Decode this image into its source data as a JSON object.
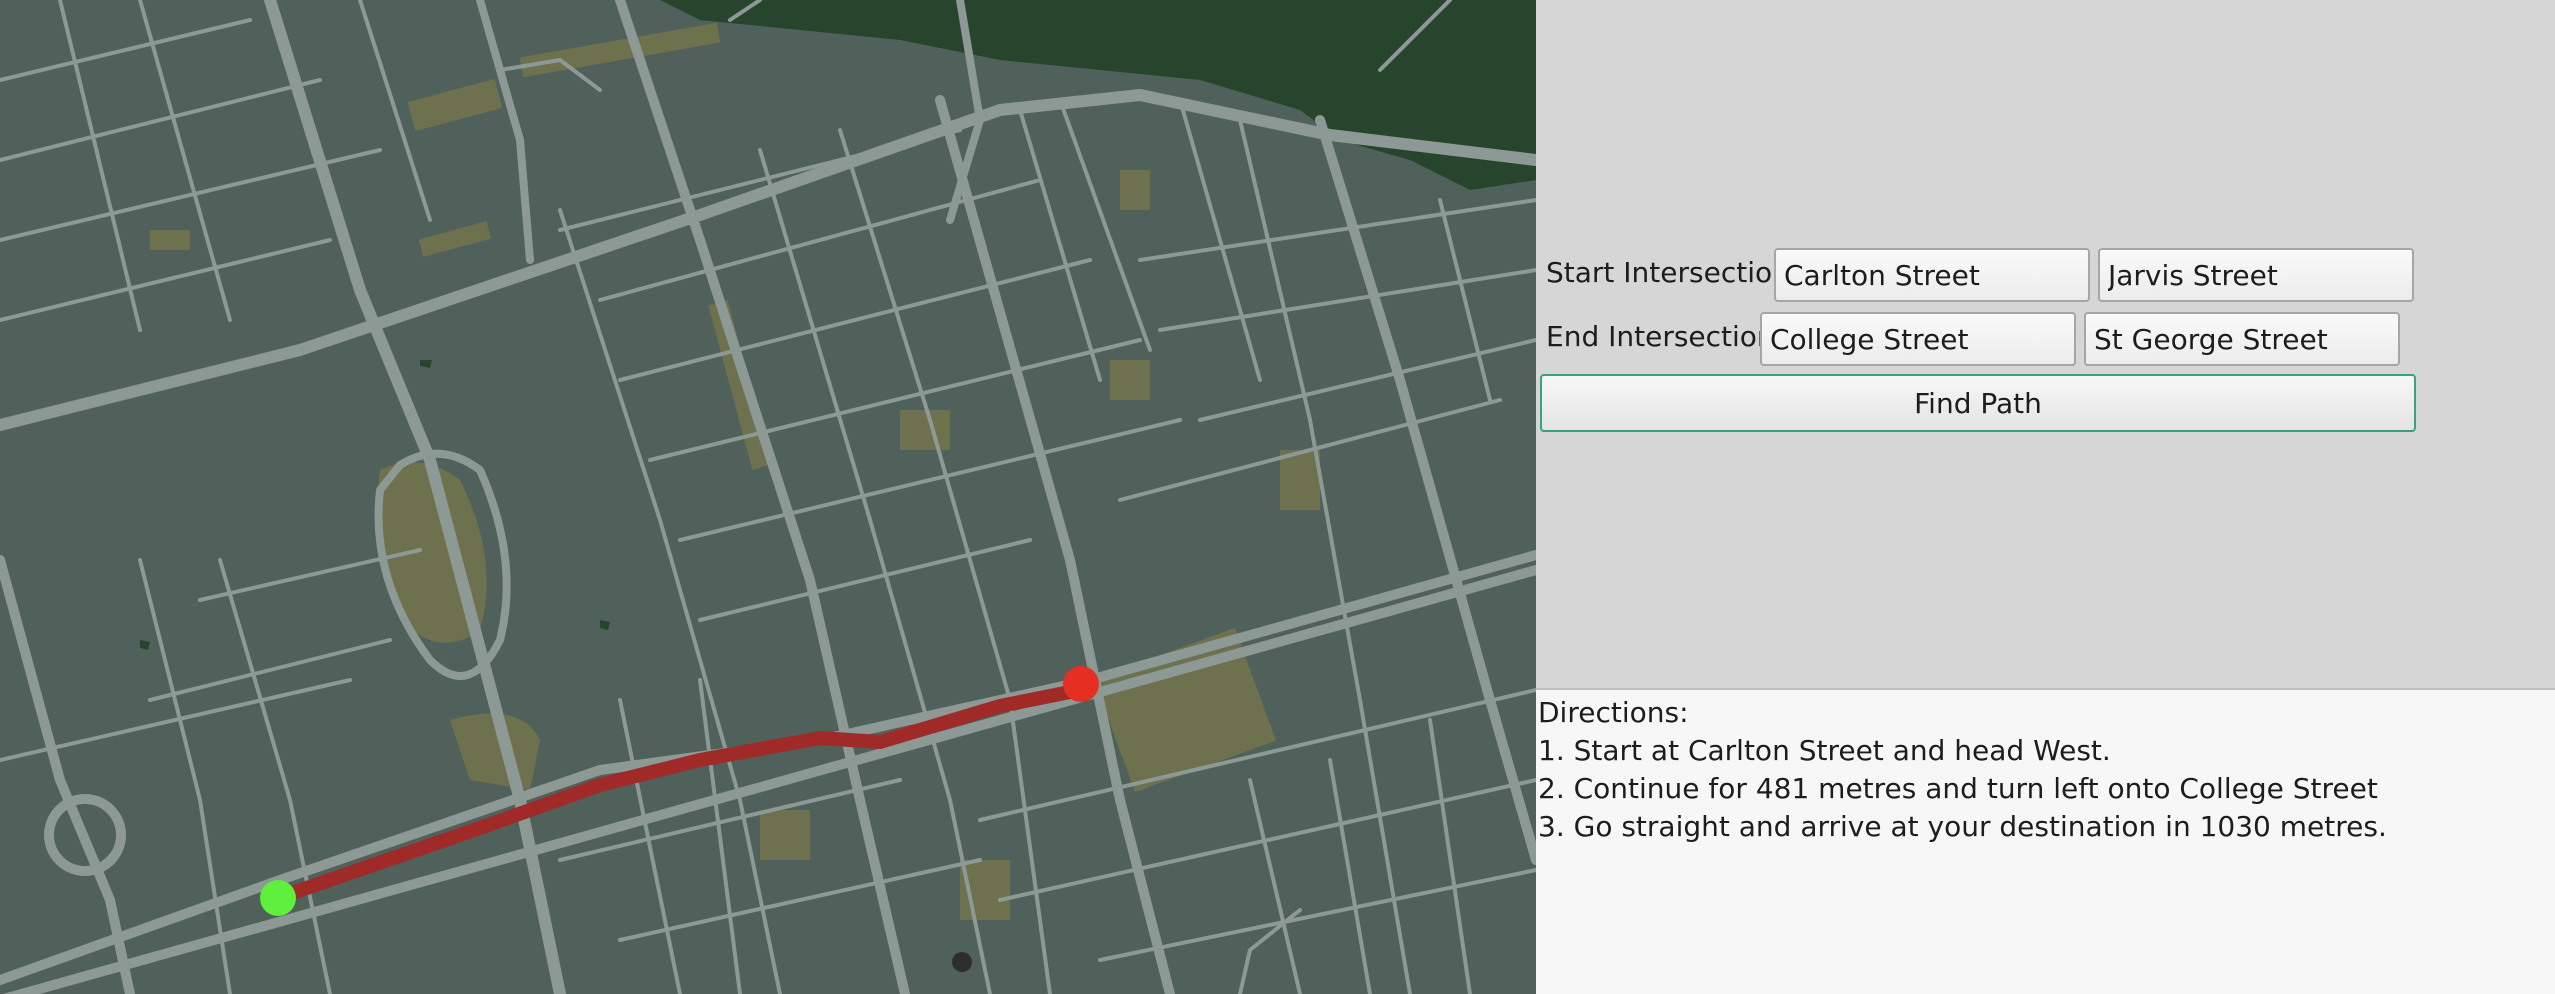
{
  "colors": {
    "map_background": "#50605a",
    "road": "#8d9995",
    "park": "#6e714e",
    "forest": "#27452d",
    "route": "#a02a28",
    "start_marker": "#5ef03c",
    "end_marker": "#e52f22"
  },
  "form": {
    "start_label": "Start Intersection",
    "start_street_1": "Carlton Street",
    "start_street_2": "Jarvis Street",
    "end_label": "End Intersection",
    "end_street_1": "College Street",
    "end_street_2": "St George Street",
    "find_button": "Find Path"
  },
  "directions": {
    "heading": "Directions:",
    "steps": [
      "1. Start at Carlton Street and head West.",
      "2. Continue for 481 metres and turn left onto College Street",
      "3. Go straight and arrive at your destination in 1030 metres."
    ]
  }
}
